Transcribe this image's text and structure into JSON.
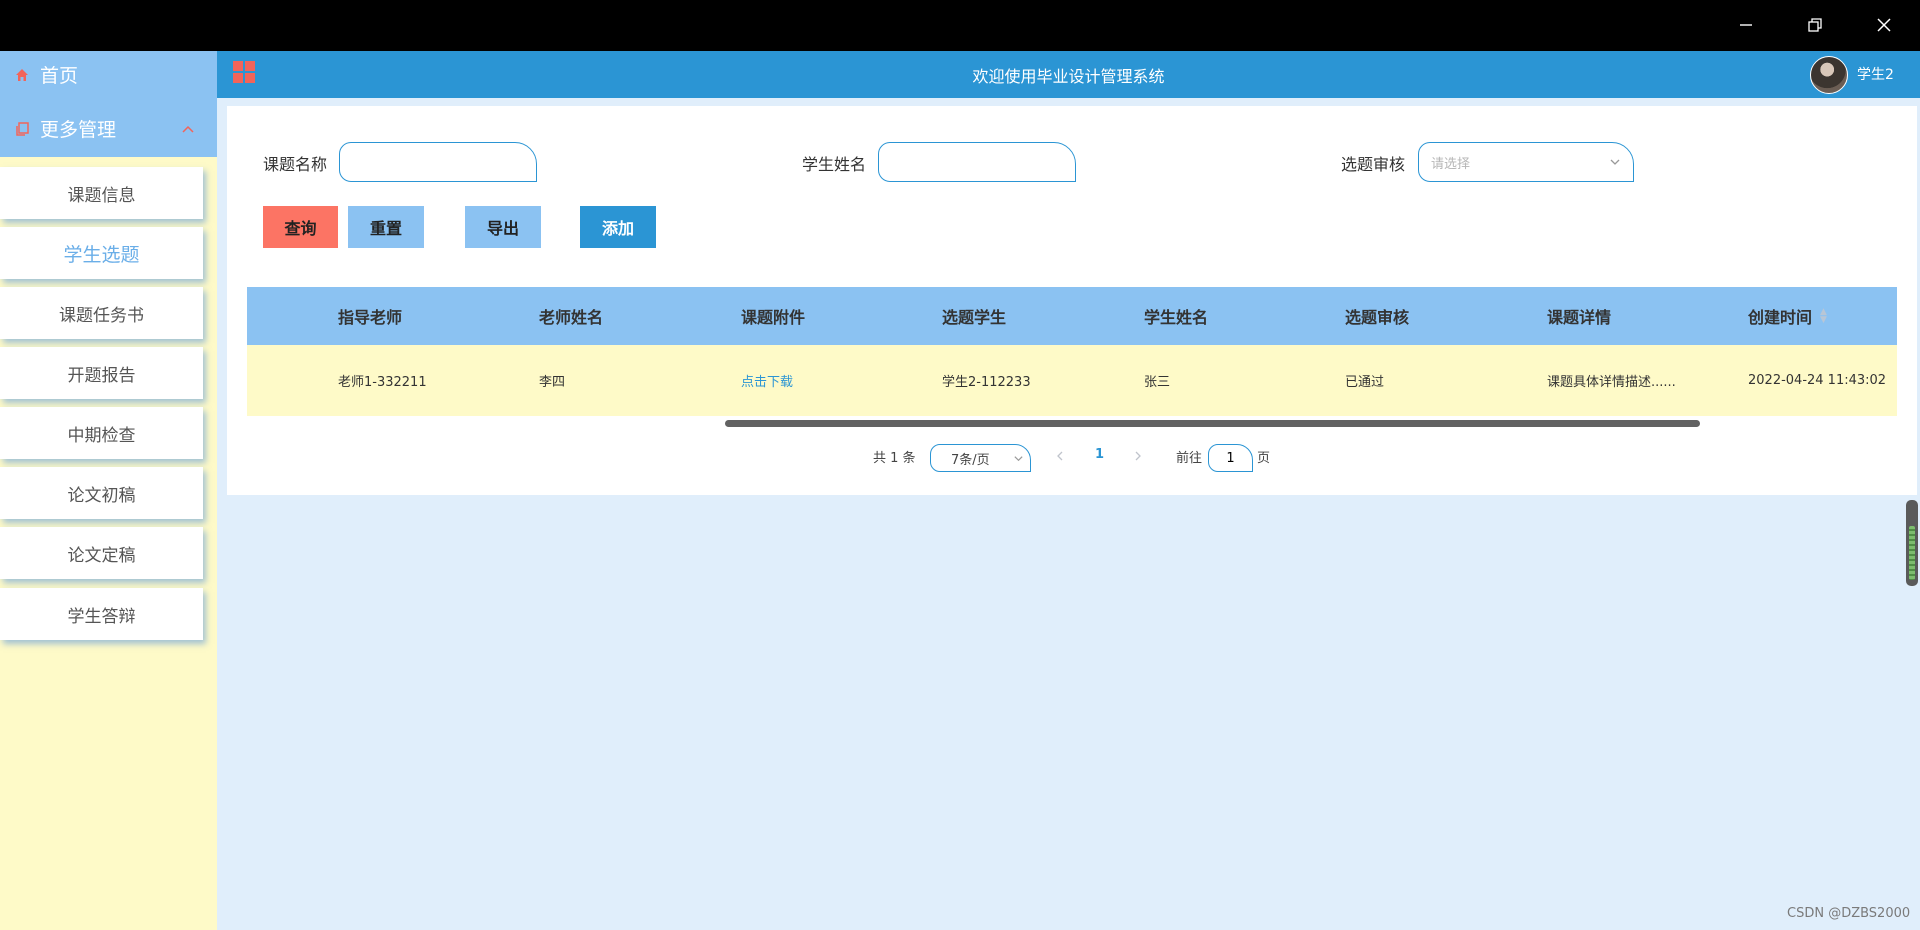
{
  "window": {
    "controls": [
      "minimize-icon",
      "restore-icon",
      "close-icon"
    ]
  },
  "header": {
    "title": "欢迎使用毕业设计管理系统",
    "user_name": "学生2",
    "menu_icon": "grid-icon"
  },
  "sidebar": {
    "home_label": "首页",
    "more_label": "更多管理",
    "items": [
      {
        "label": "课题信息"
      },
      {
        "label": "学生选题",
        "active": true
      },
      {
        "label": "课题任务书"
      },
      {
        "label": "开题报告"
      },
      {
        "label": "中期检查"
      },
      {
        "label": "论文初稿"
      },
      {
        "label": "论文定稿"
      },
      {
        "label": "学生答辩"
      }
    ]
  },
  "search": {
    "topic_label": "课题名称",
    "topic_value": "",
    "student_label": "学生姓名",
    "student_value": "",
    "review_label": "选题审核",
    "review_placeholder": "请选择"
  },
  "buttons": {
    "query": "查询",
    "reset": "重置",
    "export": "导出",
    "add": "添加"
  },
  "table": {
    "columns": [
      "指导老师",
      "老师姓名",
      "课题附件",
      "选题学生",
      "学生姓名",
      "选题审核",
      "课题详情",
      "创建时间"
    ],
    "rows": [
      [
        "老师1-332211",
        "李四",
        "点击下载",
        "学生2-112233",
        "张三",
        "已通过",
        "课题具体详情描述......",
        "2022-04-24 11:43:02"
      ]
    ]
  },
  "pagination": {
    "total_text": "共 1 条",
    "page_size": "7条/页",
    "current_page": "1",
    "goto_prefix": "前往",
    "goto_value": "1",
    "goto_suffix": "页"
  },
  "watermark": "CSDN @DZBS2000",
  "colors": {
    "header": "#2b95d4",
    "sidebar_top": "#8bc2f2",
    "sidebar_bg": "#fefac8",
    "query_button": "#fc7464",
    "add_button": "#2b95d4",
    "row_bg": "#fefac8"
  }
}
